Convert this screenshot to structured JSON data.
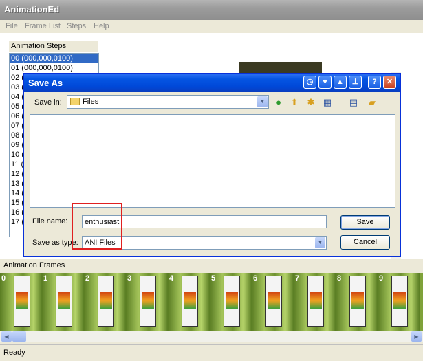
{
  "app": {
    "title": "AnimationEd"
  },
  "menu": [
    "File",
    "Frame List",
    "Steps",
    "Help"
  ],
  "steps": {
    "label": "Animation Steps",
    "items": [
      "00 (000,000,0100)",
      "01 (000,000,0100)",
      "02 (",
      "03 (",
      "04 (",
      "05 (",
      "06 (",
      "07 (",
      "08 (",
      "09 (",
      "10 (",
      "11 (",
      "12 (",
      "13 (",
      "14 (",
      "15 (",
      "16 (",
      "17 ("
    ],
    "selected_index": 0
  },
  "dialog": {
    "title": "Save As",
    "save_in_label": "Save in:",
    "save_in_value": "Files",
    "file_name_label": "File name:",
    "file_name_value": "enthusiast",
    "save_type_label": "Save as type:",
    "save_type_value": "ANI Files",
    "save_button": "Save",
    "cancel_button": "Cancel"
  },
  "frames": {
    "label": "Animation Frames",
    "numbers": [
      "0",
      "1",
      "2",
      "3",
      "4",
      "5",
      "6",
      "7",
      "8",
      "9"
    ]
  },
  "status": {
    "text": "Ready"
  },
  "colors": {
    "titlebar_inactive": "#9c9c9c",
    "dialog_title": "#0555e2",
    "selection": "#316ac5",
    "highlight_box": "#e02020"
  }
}
